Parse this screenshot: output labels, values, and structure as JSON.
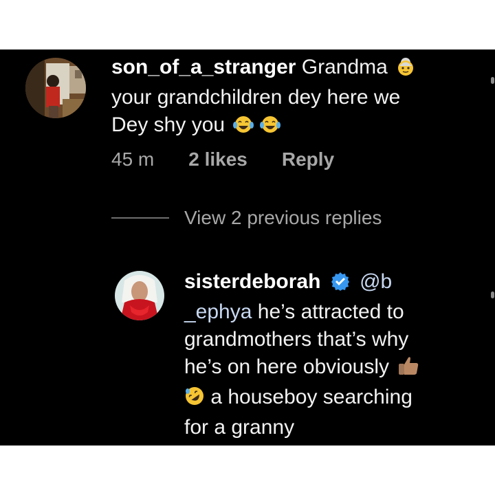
{
  "comments": [
    {
      "username": "son_of_a_stranger",
      "text_line1": "Grandma",
      "text_line2": "your grandchildren dey here we",
      "text_line3": "Dey shy you",
      "emoji1": "older-woman-icon",
      "emoji2": "tears-of-joy-icon",
      "time": "45 m",
      "likes": "2 likes",
      "reply_label": "Reply"
    }
  ],
  "view_replies_label": "View 2 previous replies",
  "reply": {
    "username": "sisterdeborah",
    "mention": "@b _ephya",
    "mention_part1": "@b",
    "mention_part2": "_ephya",
    "line2_rest": " he’s attracted to",
    "line3": "grandmothers that’s why",
    "line4": "he’s on here obviously",
    "line5": " a houseboy searching",
    "line6": "for a granny",
    "verified_icon": "verified-badge-icon",
    "thumbs_icon": "thumbs-up-icon",
    "rofl_icon": "rolling-laughing-icon"
  },
  "colors": {
    "background": "#000000",
    "text": "#f2f2f2",
    "meta": "#a8a8a8",
    "verified": "#3797f0",
    "mention": "#c8d8f2"
  }
}
